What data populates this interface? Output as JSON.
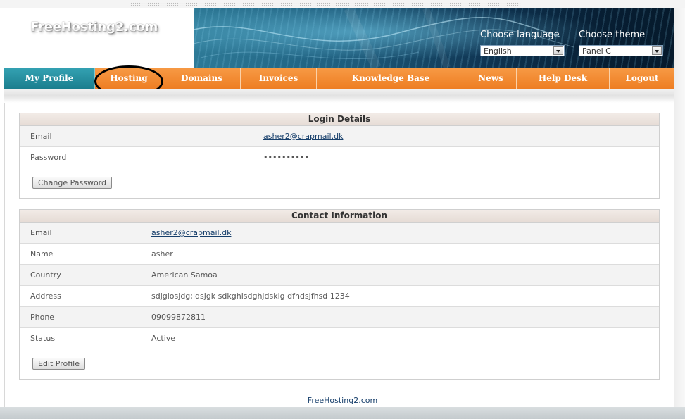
{
  "header": {
    "logo_text": "FreeHosting2.com",
    "choose_language_label": "Choose language",
    "language_value": "English",
    "choose_theme_label": "Choose theme",
    "theme_value": "Panel C"
  },
  "nav": {
    "items": [
      {
        "label": "My Profile"
      },
      {
        "label": "Hosting"
      },
      {
        "label": "Domains"
      },
      {
        "label": "Invoices"
      },
      {
        "label": "Knowledge Base"
      },
      {
        "label": "News"
      },
      {
        "label": "Help Desk"
      },
      {
        "label": "Logout"
      }
    ]
  },
  "login": {
    "title": "Login Details",
    "email_label": "Email",
    "email_value": "asher2@crapmail.dk",
    "password_label": "Password",
    "password_value": "••••••••••",
    "change_password_button": "Change Password"
  },
  "contact": {
    "title": "Contact Information",
    "rows": [
      {
        "label": "Email",
        "value": "asher2@crapmail.dk"
      },
      {
        "label": "Name",
        "value": "asher"
      },
      {
        "label": "Country",
        "value": "American Samoa"
      },
      {
        "label": "Address",
        "value": "sdjgiosjdg;ldsjgk sdkghlsdghjdsklg dfhdsjfhsd 1234"
      },
      {
        "label": "Phone",
        "value": "09099872811"
      },
      {
        "label": "Status",
        "value": "Active"
      }
    ],
    "edit_profile_button": "Edit Profile"
  },
  "footer": {
    "link_text": "FreeHosting2.com"
  },
  "colors": {
    "nav_orange": "#f28c36",
    "nav_active_teal": "#1b7e8e",
    "link_blue": "#173f6b",
    "panel_head": "#e6dcd6"
  }
}
